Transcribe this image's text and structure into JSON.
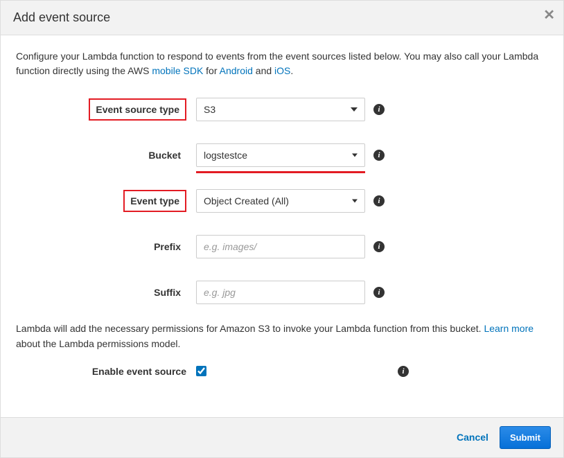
{
  "header": {
    "title": "Add event source"
  },
  "intro": {
    "text_before": "Configure your Lambda function to respond to events from the event sources listed below. You may also call your Lambda function directly using the AWS ",
    "link_mobile_sdk": "mobile SDK",
    "text_mid1": " for ",
    "link_android": "Android",
    "text_mid2": " and ",
    "link_ios": "iOS",
    "text_end": "."
  },
  "form": {
    "event_source_type": {
      "label": "Event source type",
      "value": "S3"
    },
    "bucket": {
      "label": "Bucket",
      "value": "logstestce"
    },
    "event_type": {
      "label": "Event type",
      "value": "Object Created (All)"
    },
    "prefix": {
      "label": "Prefix",
      "placeholder": "e.g. images/"
    },
    "suffix": {
      "label": "Suffix",
      "placeholder": "e.g. jpg"
    },
    "enable": {
      "label": "Enable event source"
    }
  },
  "permissions": {
    "text_before": "Lambda will add the necessary permissions for Amazon S3 to invoke your Lambda function from this bucket. ",
    "link": "Learn more",
    "text_after": " about the Lambda permissions model."
  },
  "footer": {
    "cancel": "Cancel",
    "submit": "Submit"
  }
}
